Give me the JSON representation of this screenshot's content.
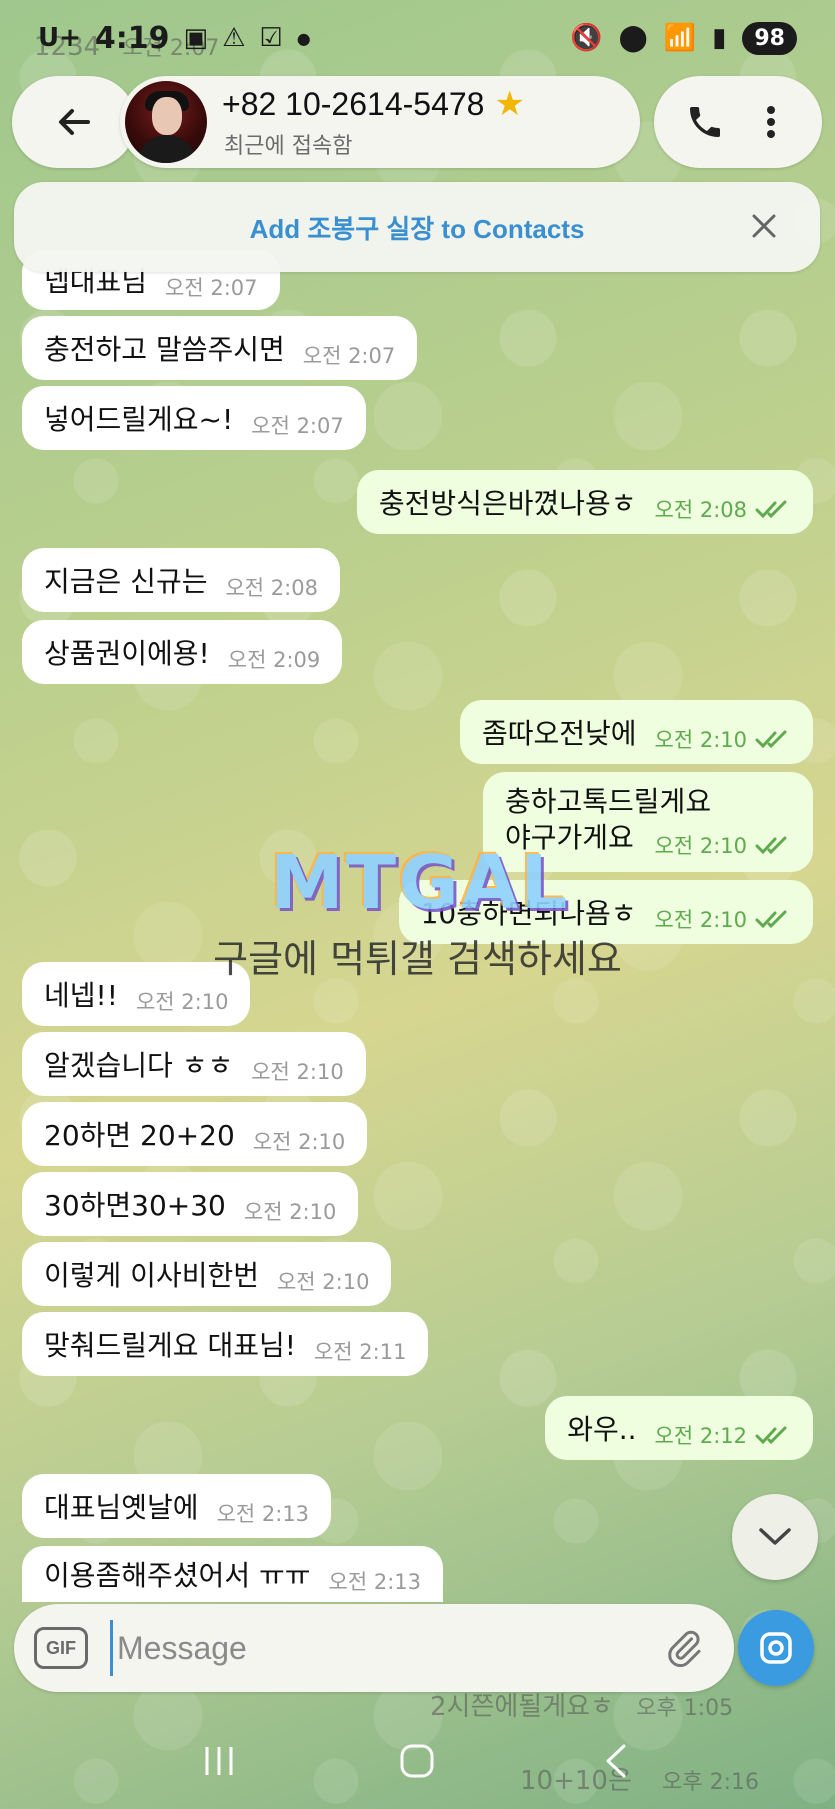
{
  "status_bar": {
    "time": "4:19",
    "carrier": "U+",
    "battery": "98",
    "icons": [
      "screenshot-icon",
      "warning-icon",
      "checkbox-icon",
      "mute-icon",
      "location-icon",
      "wifi-icon",
      "signal-icon"
    ]
  },
  "header": {
    "contact_name": "+82 10-2614-5478",
    "contact_status": "최근에 접속함",
    "star": "★"
  },
  "add_banner": {
    "text": "Add 조봉구 실장 to Contacts"
  },
  "messages": [
    {
      "dir": "in",
      "text": "넵대표님",
      "time": "오전 2:07"
    },
    {
      "dir": "in",
      "text": "충전하고 말씀주시면",
      "time": "오전 2:07"
    },
    {
      "dir": "in",
      "text": "넣어드릴게요~!",
      "time": "오전 2:07"
    },
    {
      "dir": "out",
      "text": "충전방식은바꼈나용ㅎ",
      "time": "오전 2:08"
    },
    {
      "dir": "in",
      "text": "지금은 신규는",
      "time": "오전 2:08"
    },
    {
      "dir": "in",
      "text": "상품권이에용!",
      "time": "오전 2:09"
    },
    {
      "dir": "out",
      "text": "좀따오전낮에",
      "time": "오전 2:10"
    },
    {
      "dir": "out",
      "text": "충하고톡드릴게요\n야구가게요",
      "time": "오전 2:10"
    },
    {
      "dir": "out",
      "text": "10충하면되나욤ㅎ",
      "time": "오전 2:10"
    },
    {
      "dir": "in",
      "text": "네넵!!",
      "time": "오전 2:10"
    },
    {
      "dir": "in",
      "text": "알겠습니다 ㅎㅎ",
      "time": "오전 2:10"
    },
    {
      "dir": "in",
      "text": "20하면 20+20",
      "time": "오전 2:10"
    },
    {
      "dir": "in",
      "text": "30하면30+30",
      "time": "오전 2:10"
    },
    {
      "dir": "in",
      "text": "이렇게 이사비한번",
      "time": "오전 2:10"
    },
    {
      "dir": "in",
      "text": "맞춰드릴게요 대표님!",
      "time": "오전 2:11"
    },
    {
      "dir": "out",
      "text": "와우..",
      "time": "오전 2:12"
    },
    {
      "dir": "in",
      "text": "대표님옛날에",
      "time": "오전 2:13"
    },
    {
      "dir": "in",
      "text": "이용좀해주셨어서 ㅠㅠ",
      "time": "오전 2:13"
    }
  ],
  "watermark": {
    "logo": "MTGAL",
    "caption": "구글에 먹튀갤 검색하세요"
  },
  "composer": {
    "gif_label": "GIF",
    "placeholder": "Message"
  },
  "bleed_through": {
    "top_left": "1234",
    "top_left_time": "오전 2:07",
    "bottom_msg": "2시쯘에될게요ㅎ",
    "bottom_time": "오후 1:05",
    "bottom_msg2": "10+10은",
    "bottom_time2": "오후 2:16"
  },
  "colors": {
    "accent": "#3a8fd1",
    "outgoing_bubble": "#eefedf",
    "incoming_bubble": "#ffffff",
    "read_check": "#5faa4e"
  }
}
